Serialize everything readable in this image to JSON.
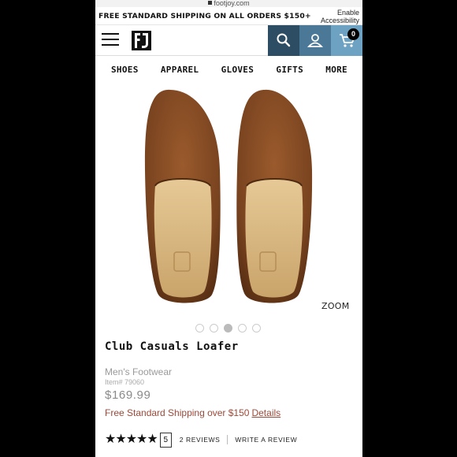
{
  "browser": {
    "url": "footjoy.com"
  },
  "promo": {
    "shipping_text": "FREE STANDARD SHIPPING ON ALL ORDERS $150+",
    "accessibility_label": "Enable Accessibility"
  },
  "header": {
    "logo_text": "FJ",
    "cart_count": "0",
    "colors": {
      "search": "#2d4d64",
      "account": "#4b7896",
      "cart": "#6ea2c2"
    }
  },
  "nav": {
    "items": [
      "SHOES",
      "APPAREL",
      "GLOVES",
      "GIFTS",
      "MORE"
    ]
  },
  "gallery": {
    "zoom_label": "ZOOM",
    "total_images": 5,
    "active_index": 2
  },
  "product": {
    "name": "Club Casuals Loafer",
    "category": "Men's Footwear",
    "item_number": "Item# 79060",
    "price": "$169.99",
    "shipping_note": "Free Standard Shipping over $150",
    "details_link": "Details"
  },
  "reviews": {
    "stars": "★★★★★",
    "rating": "5",
    "count_label": "2 REVIEWS",
    "write_label": "WRITE A REVIEW"
  }
}
